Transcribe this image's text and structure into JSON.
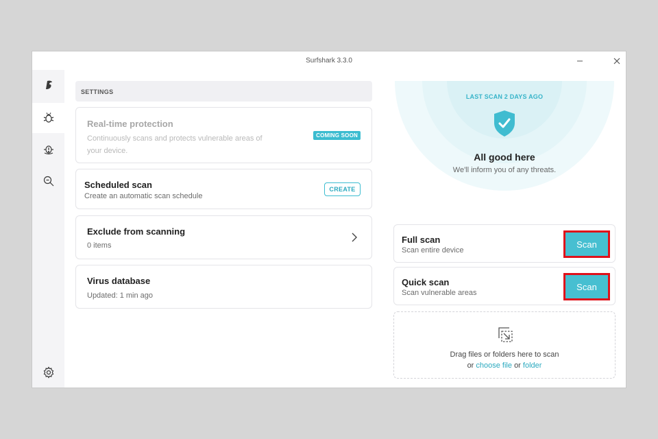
{
  "window": {
    "title": "Surfshark 3.3.0"
  },
  "settings": {
    "header": "SETTINGS",
    "realtime": {
      "title": "Real-time protection",
      "description_line1": "Continuously scans and protects vulnerable areas of",
      "description_line2": "your device.",
      "badge": "COMING SOON"
    },
    "scheduled": {
      "title": "Scheduled scan",
      "subtitle": "Create an automatic scan schedule",
      "button": "CREATE"
    },
    "exclude": {
      "title": "Exclude from scanning",
      "subtitle": "0 items"
    },
    "database": {
      "title": "Virus database",
      "subtitle": "Updated: 1 min ago"
    }
  },
  "status": {
    "last_scan": "LAST SCAN 2 DAYS AGO",
    "headline": "All good here",
    "message": "We'll inform you of any threats."
  },
  "scans": {
    "full": {
      "title": "Full scan",
      "subtitle": "Scan entire device",
      "button": "Scan"
    },
    "quick": {
      "title": "Quick scan",
      "subtitle": "Scan vulnerable areas",
      "button": "Scan"
    }
  },
  "dropzone": {
    "line1": "Drag files or folders here to scan",
    "or1": "or",
    "choose_file": "choose file",
    "or2": "or",
    "folder": "folder"
  },
  "icons": {
    "logo": "surfshark-logo-icon",
    "antivirus": "bug-icon",
    "alert": "alert-bug-icon",
    "search": "search-icon",
    "settings": "gear-icon",
    "shield": "shield-check-icon",
    "drop": "drop-files-icon"
  },
  "colors": {
    "accent": "#47bfd1",
    "highlight": "#e0101a"
  }
}
